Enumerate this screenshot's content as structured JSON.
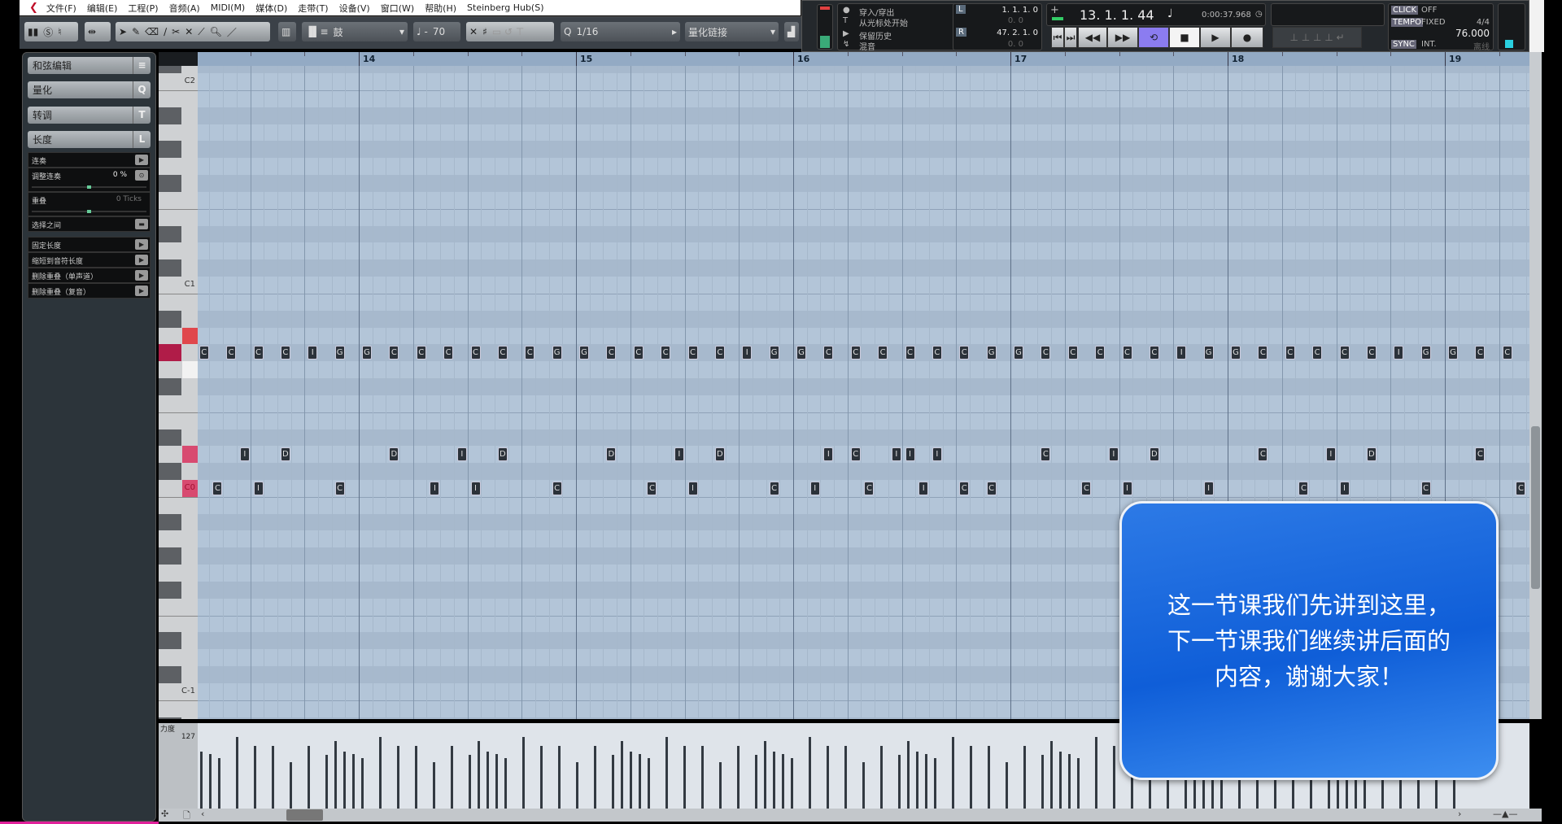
{
  "menu": {
    "items": [
      "文件(F)",
      "编辑(E)",
      "工程(P)",
      "音频(A)",
      "MIDI(M)",
      "媒体(D)",
      "走带(T)",
      "设备(V)",
      "窗口(W)",
      "帮助(H)",
      "Steinberg Hub(S)"
    ]
  },
  "toolbar": {
    "drum_label": "鼓",
    "velocity_value": "70",
    "quantize_value": "1/16",
    "quantize_link": "量化链接"
  },
  "transport": {
    "punch": "穿入/穿出",
    "start_from_cursor": "从光标处开始",
    "keep_history": "保留历史",
    "mix": "混音",
    "left_locator": "1. 1. 1.   0",
    "left_sub": "0.   0",
    "right_locator": "47. 2. 1.   0",
    "right_sub": "0.   0",
    "position": "13.  1.  1.  44",
    "time": "0:00:37.968",
    "click_label": "CLICK",
    "click_value": "OFF",
    "tempo_label": "TEMPO",
    "tempo_mode": "FIXED",
    "signature": "4/4",
    "tempo": "76.000",
    "sync_label": "SYNC",
    "sync_value": "INT.",
    "sync_extra": "离线",
    "loop_active_color": "#8b7cf0"
  },
  "left_panel": {
    "sections": [
      {
        "label": "和弦编辑",
        "key": "≡"
      },
      {
        "label": "量化",
        "key": "Q"
      },
      {
        "label": "转调",
        "key": "T"
      },
      {
        "label": "长度",
        "key": "L"
      }
    ],
    "legato": "连奏",
    "adjust_legato": "调整连奏",
    "adjust_value": "0 %",
    "overlap": "重叠",
    "overlap_value": "0 Ticks",
    "between_selected": "选择之间",
    "fixed_length": "固定长度",
    "scale_to_note_length": "缩短到音符长度",
    "delete_overlaps_mono": "删除重叠（单声道）",
    "delete_overlaps_poly": "删除重叠（复音）"
  },
  "ruler": {
    "bars": [
      "14",
      "15",
      "16",
      "17",
      "18",
      "19"
    ]
  },
  "piano": {
    "labels": [
      "C2",
      "C1",
      "C0",
      "C-1"
    ]
  },
  "notes": {
    "row_gsharp0": [
      [
        13.25,
        "C"
      ],
      [
        13.375,
        "C"
      ],
      [
        13.5,
        "C"
      ],
      [
        13.625,
        "C"
      ],
      [
        13.75,
        "I"
      ],
      [
        13.875,
        "G"
      ],
      [
        14.0,
        "G"
      ],
      [
        14.125,
        "C"
      ],
      [
        14.25,
        "C"
      ],
      [
        14.375,
        "C"
      ],
      [
        14.5,
        "C"
      ],
      [
        14.625,
        "C"
      ],
      [
        14.75,
        "C"
      ],
      [
        14.875,
        "G"
      ],
      [
        15.0,
        "G"
      ],
      [
        15.125,
        "C"
      ],
      [
        15.25,
        "C"
      ],
      [
        15.375,
        "C"
      ],
      [
        15.5,
        "C"
      ],
      [
        15.625,
        "C"
      ],
      [
        15.75,
        "I"
      ],
      [
        15.875,
        "G"
      ],
      [
        16.0,
        "G"
      ],
      [
        16.125,
        "C"
      ],
      [
        16.25,
        "C"
      ],
      [
        16.375,
        "C"
      ],
      [
        16.5,
        "C"
      ],
      [
        16.625,
        "C"
      ],
      [
        16.75,
        "C"
      ],
      [
        16.875,
        "G"
      ],
      [
        17.0,
        "G"
      ],
      [
        17.125,
        "C"
      ],
      [
        17.25,
        "C"
      ],
      [
        17.375,
        "C"
      ],
      [
        17.5,
        "C"
      ],
      [
        17.625,
        "C"
      ],
      [
        17.75,
        "I"
      ],
      [
        17.875,
        "G"
      ],
      [
        18.0,
        "G"
      ],
      [
        18.125,
        "C"
      ],
      [
        18.25,
        "C"
      ],
      [
        18.375,
        "C"
      ],
      [
        18.5,
        "C"
      ],
      [
        18.625,
        "C"
      ],
      [
        18.75,
        "I"
      ],
      [
        18.875,
        "G"
      ],
      [
        19.0,
        "G"
      ],
      [
        19.125,
        "C"
      ],
      [
        19.25,
        "C"
      ]
    ],
    "row_d0": [
      [
        13.4375,
        "I"
      ],
      [
        13.625,
        "D"
      ],
      [
        14.125,
        "D"
      ],
      [
        14.4375,
        "I"
      ],
      [
        14.625,
        "D"
      ],
      [
        15.125,
        "D"
      ],
      [
        15.4375,
        "I"
      ],
      [
        15.625,
        "D"
      ],
      [
        16.125,
        "I"
      ],
      [
        16.25,
        "C"
      ],
      [
        16.4375,
        "I"
      ],
      [
        16.5,
        "I"
      ],
      [
        16.625,
        "I"
      ],
      [
        17.125,
        "C"
      ],
      [
        17.4375,
        "I"
      ],
      [
        17.625,
        "D"
      ],
      [
        18.125,
        "C"
      ],
      [
        18.4375,
        "I"
      ],
      [
        18.625,
        "D"
      ],
      [
        19.125,
        "C"
      ]
    ],
    "row_c0": [
      [
        13.3125,
        "C"
      ],
      [
        13.5,
        "I"
      ],
      [
        13.875,
        "C"
      ],
      [
        14.3125,
        "I"
      ],
      [
        14.5,
        "I"
      ],
      [
        14.875,
        "C"
      ],
      [
        15.3125,
        "C"
      ],
      [
        15.5,
        "I"
      ],
      [
        15.875,
        "C"
      ],
      [
        16.0625,
        "I"
      ],
      [
        16.3125,
        "C"
      ],
      [
        16.5625,
        "I"
      ],
      [
        16.75,
        "C"
      ],
      [
        16.875,
        "C"
      ],
      [
        17.3125,
        "C"
      ],
      [
        17.5,
        "I"
      ],
      [
        17.875,
        "I"
      ],
      [
        18.3125,
        "C"
      ],
      [
        18.5,
        "I"
      ],
      [
        18.875,
        "C"
      ],
      [
        19.3125,
        "C"
      ]
    ]
  },
  "velocity": {
    "label": "力度",
    "max_label": "127",
    "values": [
      95,
      120,
      101,
      96,
      89,
      127,
      111,
      111,
      83,
      111,
      95,
      120,
      101,
      96,
      89,
      127,
      111,
      111,
      83,
      111,
      95,
      120,
      101,
      96,
      89,
      127,
      111,
      111,
      83,
      111,
      95,
      120,
      101,
      96,
      89,
      127,
      111,
      111,
      83,
      111,
      95,
      120,
      101,
      96,
      89,
      127,
      111,
      111,
      83,
      111,
      95,
      120,
      101,
      96,
      89,
      127,
      111,
      111,
      83,
      111,
      95,
      120,
      101,
      96,
      89,
      127,
      111,
      111,
      83,
      111,
      95,
      120,
      101,
      96,
      89,
      127,
      111,
      111,
      83,
      111,
      95,
      120,
      101,
      96,
      89,
      127,
      111,
      111,
      83,
      111
    ]
  },
  "callout": {
    "lines": [
      "这一节课我们先讲到这里，",
      "下一节课我们继续讲后面的",
      "内容，谢谢大家！"
    ]
  }
}
